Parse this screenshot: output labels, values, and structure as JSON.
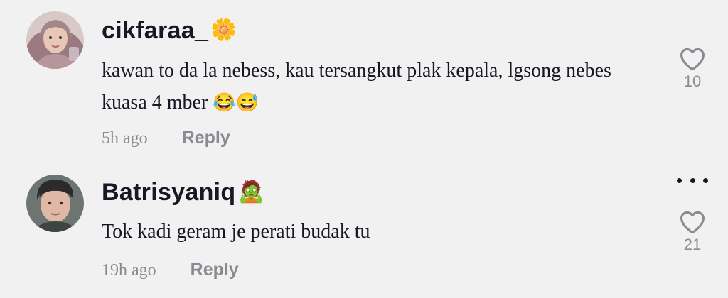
{
  "comments": [
    {
      "username": "cikfaraa_",
      "username_emoji": "🌼",
      "text": "kawan to da la nebess, kau tersangkut plak kepala, lgsong nebes kuasa 4 mber",
      "text_emoji": "😂😅",
      "time": "5h ago",
      "reply_label": "Reply",
      "likes": "10"
    },
    {
      "username": "Batrisyaniq",
      "username_emoji": "🧟",
      "text": "Tok kadi geram je perati budak tu",
      "time": "19h ago",
      "reply_label": "Reply",
      "likes": "21"
    }
  ],
  "icons": {
    "like": "heart-outline-icon",
    "more": "more-horizontal-icon"
  },
  "colors": {
    "background": "#f1f1f2",
    "text_primary": "#161823",
    "text_secondary": "#8a8b91"
  }
}
